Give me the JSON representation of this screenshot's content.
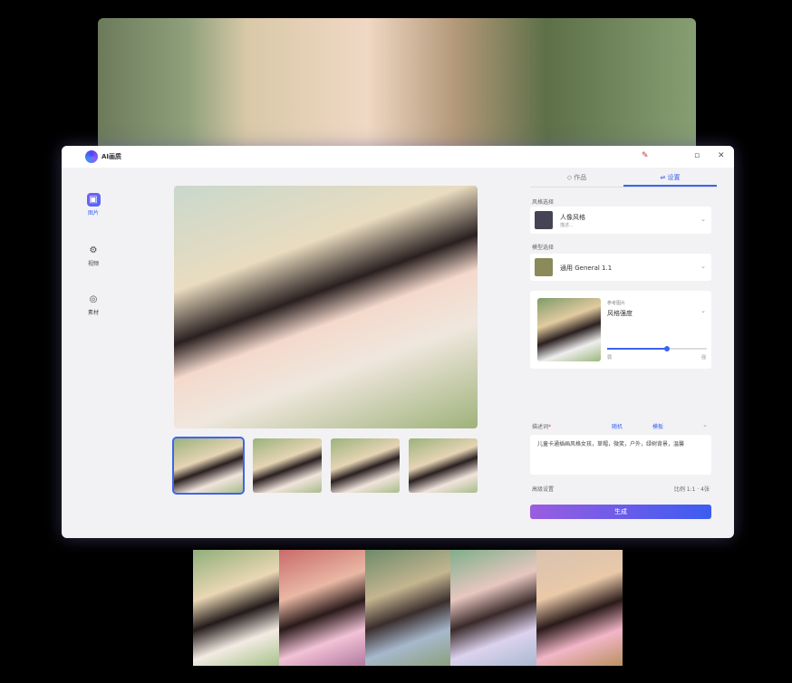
{
  "app": {
    "title": "AI画质"
  },
  "sidebar": {
    "items": [
      {
        "label": "图片",
        "icon": "image-icon"
      },
      {
        "label": "视频",
        "icon": "video-icon"
      },
      {
        "label": "素材",
        "icon": "material-icon"
      }
    ]
  },
  "panel": {
    "tabs": [
      {
        "label": "作品"
      },
      {
        "label": "设置"
      }
    ],
    "style_label": "风格选择",
    "style": {
      "name": "人像风格",
      "desc": "描述..."
    },
    "model_label": "模型选择",
    "model": {
      "name": "通用 General 1.1"
    },
    "ref": {
      "label": "参考图片",
      "name": "风格强度",
      "min": "弱",
      "max": "强",
      "strength": 0.6
    },
    "prompt": {
      "label": "描述词",
      "required": "*",
      "opt1": "随机",
      "opt2": "模板",
      "text": "儿童卡通插画风格女孩，草帽，微笑，户外，绿树背景，温馨"
    },
    "advanced": "高级设置",
    "ratio": "比例 1:1 · 4张",
    "generate": "生成"
  }
}
